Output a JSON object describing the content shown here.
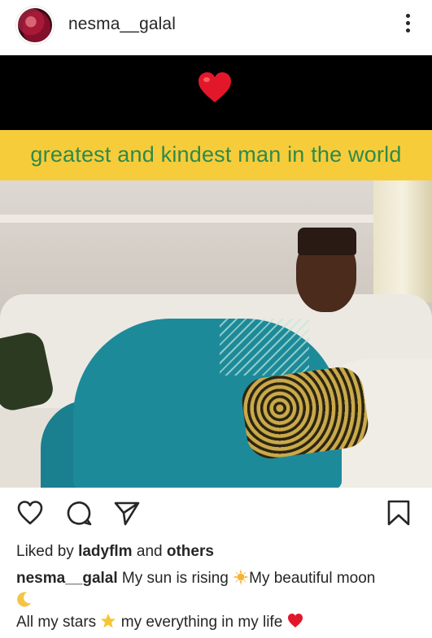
{
  "post": {
    "username": "nesma__galal",
    "media": {
      "banner_text": "greatest and kindest man in the world",
      "top_emoji": "heart-emoji"
    },
    "likes": {
      "prefix": "Liked by",
      "user": "ladyflm",
      "conjunction": "and",
      "others": "others"
    },
    "caption": {
      "user": "nesma__galal",
      "part1": "My sun is rising",
      "part2": "My beautiful moon",
      "part3": "All my stars",
      "part4": "my everything in my life"
    },
    "icons": {
      "more": "more-vertical-icon",
      "like": "heart-outline-icon",
      "comment": "comment-bubble-icon",
      "share": "paper-plane-icon",
      "save": "bookmark-icon"
    },
    "colors": {
      "banner_bg": "#f7cc3a",
      "banner_text": "#2e8a4a",
      "heart": "#e3172a"
    }
  }
}
